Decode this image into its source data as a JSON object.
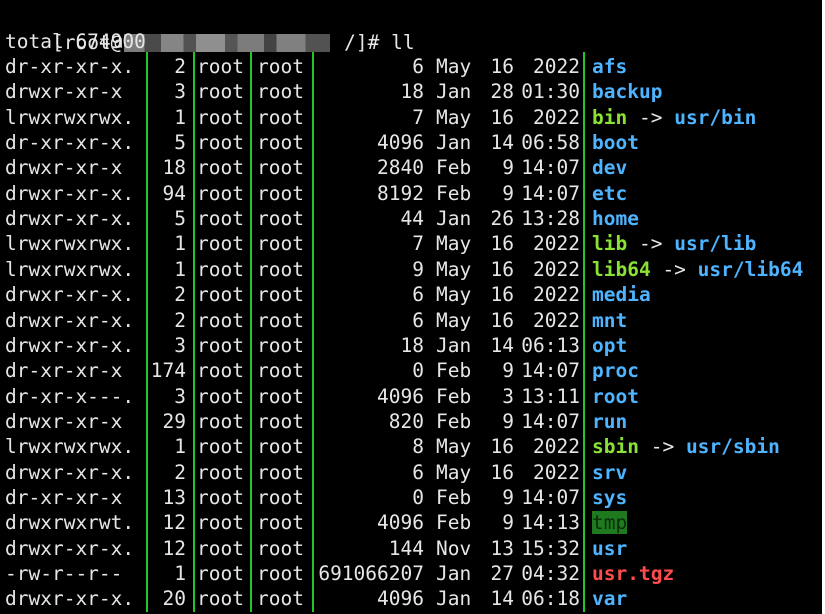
{
  "terminal": {
    "prompt_prefix": "[root@",
    "prompt_path": " /]#",
    "command": " ll",
    "total": "total 674900",
    "redacted_hostname": "blurred hostname"
  },
  "rows": [
    {
      "permissions": "dr-xr-xr-x.",
      "links": "2",
      "owner": "root",
      "group": "root",
      "size": "6",
      "month": "May",
      "day": "16",
      "time_year": "2022",
      "name": "afs",
      "target": "",
      "type": "dir"
    },
    {
      "permissions": "drwxr-xr-x",
      "links": "3",
      "owner": "root",
      "group": "root",
      "size": "18",
      "month": "Jan",
      "day": "28",
      "time_year": "01:30",
      "name": "backup",
      "target": "",
      "type": "dir"
    },
    {
      "permissions": "lrwxrwxrwx.",
      "links": "1",
      "owner": "root",
      "group": "root",
      "size": "7",
      "month": "May",
      "day": "16",
      "time_year": "2022",
      "name": "bin",
      "target": "usr/bin",
      "type": "link"
    },
    {
      "permissions": "dr-xr-xr-x.",
      "links": "5",
      "owner": "root",
      "group": "root",
      "size": "4096",
      "month": "Jan",
      "day": "14",
      "time_year": "06:58",
      "name": "boot",
      "target": "",
      "type": "dir"
    },
    {
      "permissions": "drwxr-xr-x",
      "links": "18",
      "owner": "root",
      "group": "root",
      "size": "2840",
      "month": "Feb",
      "day": "9",
      "time_year": "14:07",
      "name": "dev",
      "target": "",
      "type": "dir"
    },
    {
      "permissions": "drwxr-xr-x.",
      "links": "94",
      "owner": "root",
      "group": "root",
      "size": "8192",
      "month": "Feb",
      "day": "9",
      "time_year": "14:07",
      "name": "etc",
      "target": "",
      "type": "dir"
    },
    {
      "permissions": "drwxr-xr-x.",
      "links": "5",
      "owner": "root",
      "group": "root",
      "size": "44",
      "month": "Jan",
      "day": "26",
      "time_year": "13:28",
      "name": "home",
      "target": "",
      "type": "dir"
    },
    {
      "permissions": "lrwxrwxrwx.",
      "links": "1",
      "owner": "root",
      "group": "root",
      "size": "7",
      "month": "May",
      "day": "16",
      "time_year": "2022",
      "name": "lib",
      "target": "usr/lib",
      "type": "link"
    },
    {
      "permissions": "lrwxrwxrwx.",
      "links": "1",
      "owner": "root",
      "group": "root",
      "size": "9",
      "month": "May",
      "day": "16",
      "time_year": "2022",
      "name": "lib64",
      "target": "usr/lib64",
      "type": "link"
    },
    {
      "permissions": "drwxr-xr-x.",
      "links": "2",
      "owner": "root",
      "group": "root",
      "size": "6",
      "month": "May",
      "day": "16",
      "time_year": "2022",
      "name": "media",
      "target": "",
      "type": "dir"
    },
    {
      "permissions": "drwxr-xr-x.",
      "links": "2",
      "owner": "root",
      "group": "root",
      "size": "6",
      "month": "May",
      "day": "16",
      "time_year": "2022",
      "name": "mnt",
      "target": "",
      "type": "dir"
    },
    {
      "permissions": "drwxr-xr-x.",
      "links": "3",
      "owner": "root",
      "group": "root",
      "size": "18",
      "month": "Jan",
      "day": "14",
      "time_year": "06:13",
      "name": "opt",
      "target": "",
      "type": "dir"
    },
    {
      "permissions": "dr-xr-xr-x",
      "links": "174",
      "owner": "root",
      "group": "root",
      "size": "0",
      "month": "Feb",
      "day": "9",
      "time_year": "14:07",
      "name": "proc",
      "target": "",
      "type": "dir"
    },
    {
      "permissions": "dr-xr-x---.",
      "links": "3",
      "owner": "root",
      "group": "root",
      "size": "4096",
      "month": "Feb",
      "day": "3",
      "time_year": "13:11",
      "name": "root",
      "target": "",
      "type": "dir"
    },
    {
      "permissions": "drwxr-xr-x",
      "links": "29",
      "owner": "root",
      "group": "root",
      "size": "820",
      "month": "Feb",
      "day": "9",
      "time_year": "14:07",
      "name": "run",
      "target": "",
      "type": "dir"
    },
    {
      "permissions": "lrwxrwxrwx.",
      "links": "1",
      "owner": "root",
      "group": "root",
      "size": "8",
      "month": "May",
      "day": "16",
      "time_year": "2022",
      "name": "sbin",
      "target": "usr/sbin",
      "type": "link"
    },
    {
      "permissions": "drwxr-xr-x.",
      "links": "2",
      "owner": "root",
      "group": "root",
      "size": "6",
      "month": "May",
      "day": "16",
      "time_year": "2022",
      "name": "srv",
      "target": "",
      "type": "dir"
    },
    {
      "permissions": "dr-xr-xr-x",
      "links": "13",
      "owner": "root",
      "group": "root",
      "size": "0",
      "month": "Feb",
      "day": "9",
      "time_year": "14:07",
      "name": "sys",
      "target": "",
      "type": "dir"
    },
    {
      "permissions": "drwxrwxrwt.",
      "links": "12",
      "owner": "root",
      "group": "root",
      "size": "4096",
      "month": "Feb",
      "day": "9",
      "time_year": "14:13",
      "name": "tmp",
      "target": "",
      "type": "sticky"
    },
    {
      "permissions": "drwxr-xr-x.",
      "links": "12",
      "owner": "root",
      "group": "root",
      "size": "144",
      "month": "Nov",
      "day": "13",
      "time_year": "15:32",
      "name": "usr",
      "target": "",
      "type": "dir"
    },
    {
      "permissions": "-rw-r--r--",
      "links": "1",
      "owner": "root",
      "group": "root",
      "size": "691066207",
      "month": "Jan",
      "day": "27",
      "time_year": "04:32",
      "name": "usr.tgz",
      "target": "",
      "type": "archive"
    },
    {
      "permissions": "drwxr-xr-x.",
      "links": "20",
      "owner": "root",
      "group": "root",
      "size": "4096",
      "month": "Jan",
      "day": "14",
      "time_year": "06:18",
      "name": "var",
      "target": "",
      "type": "dir"
    }
  ],
  "colors": {
    "background": "#000000",
    "text": "#e6e6e6",
    "directory": "#4fb4ff",
    "symlink": "#8ae234",
    "archive": "#ff4b4b",
    "sticky_dir_background": "#1f7a1f",
    "guide_lines": "#24c624"
  }
}
